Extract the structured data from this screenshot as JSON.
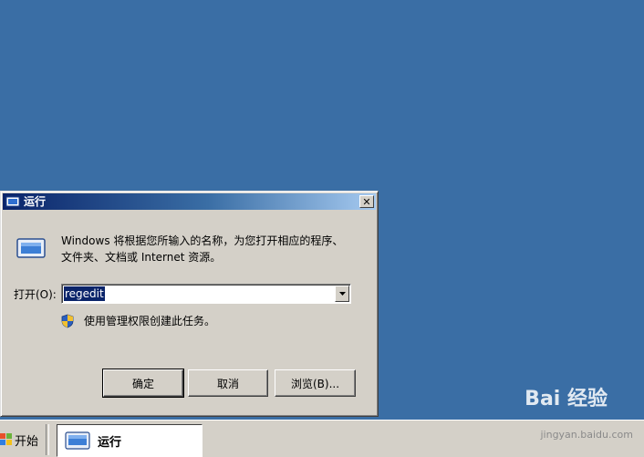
{
  "dialog": {
    "title": "运行",
    "close_label": "✕",
    "description_line1": "Windows 将根据您所输入的名称，为您打开相应的程序、",
    "description_line2": "文件夹、文档或 Internet 资源。",
    "open_label": "打开(O):",
    "open_value": "regedit",
    "admin_note": "使用管理权限创建此任务。",
    "buttons": {
      "ok": "确定",
      "cancel": "取消",
      "browse": "浏览(B)..."
    }
  },
  "taskbar": {
    "start_label": "开始",
    "task_label": "运行"
  },
  "watermark": {
    "logo_text": "Bai 经验",
    "url": "jingyan.baidu.com"
  },
  "colors": {
    "desktop": "#3a6ea5",
    "titlebar": "#0a246a",
    "face": "#d4d0c8"
  },
  "icons": [
    "run-icon",
    "shield-icon",
    "close-icon",
    "dropdown-arrow-icon",
    "windows-start-icon"
  ]
}
